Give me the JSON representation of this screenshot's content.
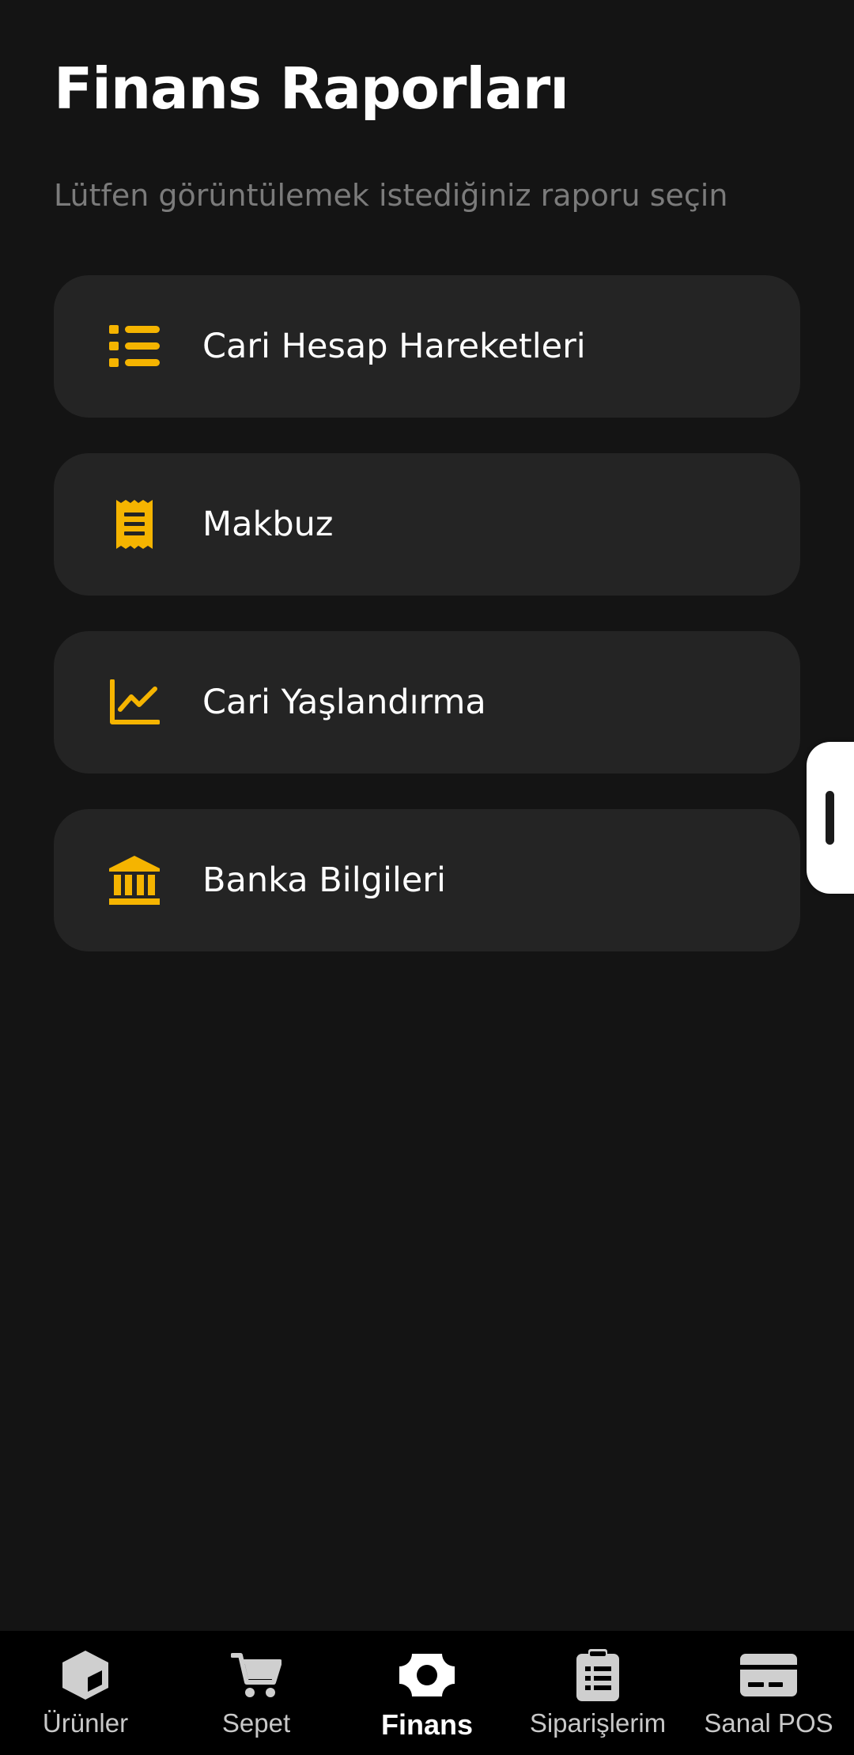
{
  "header": {
    "title": "Finans Raporları",
    "subtitle": "Lütfen görüntülemek istediğiniz raporu seçin"
  },
  "colors": {
    "accent": "#F5B400",
    "background": "#141414",
    "card": "#242424",
    "nav_background": "#000000"
  },
  "menu": {
    "items": [
      {
        "label": "Cari Hesap Hareketleri",
        "icon": "list-icon"
      },
      {
        "label": "Makbuz",
        "icon": "receipt-icon"
      },
      {
        "label": "Cari Yaşlandırma",
        "icon": "line-chart-icon"
      },
      {
        "label": "Banka Bilgileri",
        "icon": "bank-icon"
      }
    ]
  },
  "bottom_nav": {
    "active": "Finans",
    "items": [
      {
        "label": "Ürünler",
        "icon": "cube-icon"
      },
      {
        "label": "Sepet",
        "icon": "cart-icon"
      },
      {
        "label": "Finans",
        "icon": "money-icon"
      },
      {
        "label": "Siparişlerim",
        "icon": "clipboard-icon"
      },
      {
        "label": "Sanal POS",
        "icon": "credit-card-icon"
      }
    ]
  }
}
